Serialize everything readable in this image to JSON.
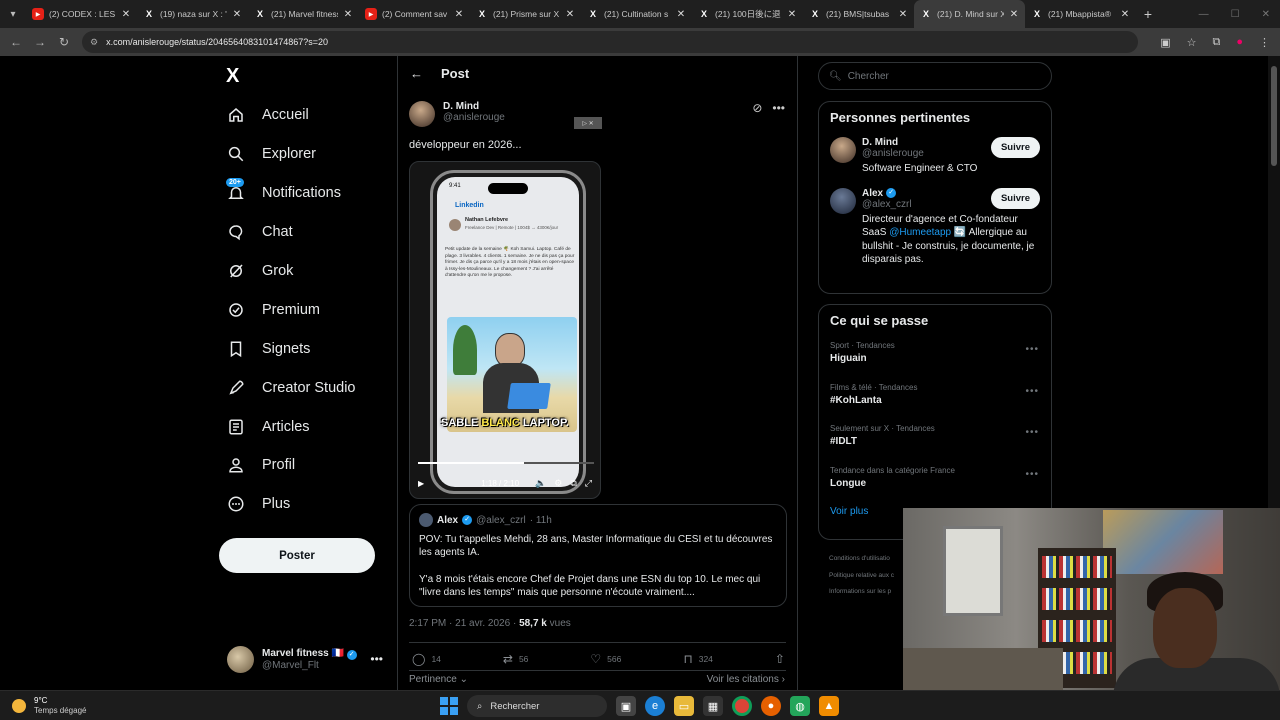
{
  "browser": {
    "tabs": [
      {
        "title": "(2) CODEX : LES A",
        "favicon": "youtube-icon",
        "active": false
      },
      {
        "title": "(19) naza sur X : \"",
        "favicon": "x-icon",
        "active": false
      },
      {
        "title": "(21) Marvel fitness",
        "favicon": "x-icon",
        "active": false
      },
      {
        "title": "(2) Comment sav",
        "favicon": "youtube-icon",
        "active": false
      },
      {
        "title": "(21) Prisme sur X",
        "favicon": "x-icon",
        "active": false
      },
      {
        "title": "(21) Cultination s",
        "favicon": "x-icon",
        "active": false
      },
      {
        "title": "(21) 100日後に退",
        "favicon": "x-icon",
        "active": false
      },
      {
        "title": "(21) BMS|tsubas",
        "favicon": "x-icon",
        "active": false
      },
      {
        "title": "(21) D. Mind sur X",
        "favicon": "x-icon",
        "active": true
      },
      {
        "title": "(21) Mbappista®",
        "favicon": "x-icon",
        "active": false
      }
    ],
    "url": "x.com/anislerouge/status/2046564083101474867?s=20"
  },
  "nav": {
    "logo": "X",
    "items": [
      {
        "label": "Accueil",
        "icon": "home-icon"
      },
      {
        "label": "Explorer",
        "icon": "search-icon"
      },
      {
        "label": "Notifications",
        "icon": "bell-icon",
        "badge": "20+"
      },
      {
        "label": "Chat",
        "icon": "chat-icon"
      },
      {
        "label": "Grok",
        "icon": "grok-icon"
      },
      {
        "label": "Premium",
        "icon": "premium-icon"
      },
      {
        "label": "Signets",
        "icon": "bookmark-icon"
      },
      {
        "label": "Creator Studio",
        "icon": "rocket-icon"
      },
      {
        "label": "Articles",
        "icon": "article-icon"
      },
      {
        "label": "Profil",
        "icon": "person-icon"
      },
      {
        "label": "Plus",
        "icon": "more-circle-icon"
      }
    ],
    "post_button": "Poster",
    "account": {
      "name": "Marvel fitness",
      "flag": "🇫🇷",
      "handle": "@Marvel_Flt"
    }
  },
  "post": {
    "header": "Post",
    "author": {
      "name": "D. Mind",
      "handle": "@anislerouge"
    },
    "text": "développeur en 2026...",
    "video": {
      "phone_time": "9:41",
      "linkedin": "Linkedin",
      "li_name": "Nathan Lefebvre",
      "li_sub": "Freelance Dev | Remote | 1004$ → 4300€/jour",
      "li_text": "Petit update de la semaine 🌴 Koh Samui. Laptop. Café de plage. 3 livrables. 4 clients. 1 semaine. Je ne dis pas ça pour frimer. Je dis ça parce qu'il y a 18 mois j'étais en open-space à Issy-les-Moulineaux. Le changement ? J'ai arrêté d'attendre qu'on me le propose.",
      "caption_a": "SABLE ",
      "caption_b": "BLANC",
      "caption_c": " LAPTOP.",
      "time": "1:18 / 2:10",
      "progress": 0.6
    },
    "quote": {
      "name": "Alex",
      "handle": "@alex_czrl",
      "age": "· 11h",
      "p1": "POV: Tu t'appelles Mehdi, 28 ans, Master Informatique du CESI et tu découvres les agents IA.",
      "p2": "Y'a 8 mois t'étais encore Chef de Projet dans une ESN du top 10. Le mec qui \"livre dans les temps\" mais que personne n'écoute vraiment...."
    },
    "timestamp": "2:17 PM · 21 avr. 2026 ·",
    "views": "58,7 k",
    "views_label": "vues",
    "stats": {
      "replies": "14",
      "reposts": "56",
      "likes": "566",
      "bookmarks": "324"
    },
    "sort_label": "Pertinence",
    "quotes_label": "Voir les citations"
  },
  "sidebar": {
    "search_placeholder": "Chercher",
    "people_title": "Personnes pertinentes",
    "people": [
      {
        "name": "D. Mind",
        "handle": "@anislerouge",
        "bio": "Software Engineer & CTO",
        "follow": "Suivre",
        "verified": false
      },
      {
        "name": "Alex",
        "handle": "@alex_czrl",
        "bio_a": "Directeur d'agence et Co-fondateur SaaS ",
        "bio_link": "@Humeetapp",
        "bio_b": " 🔄 Allergique au bullshit - Je construis, je documente, je disparais pas.",
        "follow": "Suivre",
        "verified": true
      }
    ],
    "trends_title": "Ce qui se passe",
    "trends": [
      {
        "category": "Sport · Tendances",
        "name": "Higuain"
      },
      {
        "category": "Films & télé · Tendances",
        "name": "#KohLanta"
      },
      {
        "category": "Seulement sur X · Tendances",
        "name": "#IDLT"
      },
      {
        "category": "Tendance dans la catégorie France",
        "name": "Longue"
      }
    ],
    "see_more": "Voir plus",
    "footer": [
      "Conditions d'utilisatio",
      "Politique relative aux c",
      "Informations sur les p"
    ]
  },
  "taskbar": {
    "temp": "9°C",
    "weather": "Temps dégagé",
    "search": "Rechercher"
  },
  "colors": {
    "accent": "#1d9bf0",
    "bg": "#000000",
    "text": "#e7e9ea",
    "muted": "#71767b"
  }
}
